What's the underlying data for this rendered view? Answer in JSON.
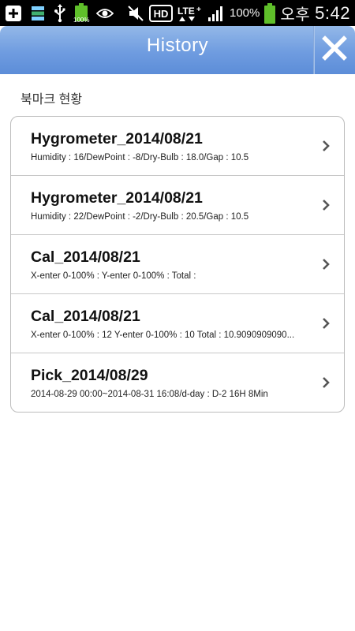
{
  "status_bar": {
    "battery_small_label": "100%",
    "hd_label": "HD",
    "lte_label": "LTE",
    "battery_percent": "100%",
    "ampm": "오후",
    "time": "5:42"
  },
  "header": {
    "title": "History",
    "close_icon": "close-icon"
  },
  "section": {
    "label": "북마크 현황"
  },
  "items": [
    {
      "title": "Hygrometer_2014/08/21",
      "subtitle": "Humidity : 16/DewPoint : -8/Dry-Bulb : 18.0/Gap : 10.5"
    },
    {
      "title": "Hygrometer_2014/08/21",
      "subtitle": "Humidity : 22/DewPoint : -2/Dry-Bulb : 20.5/Gap : 10.5"
    },
    {
      "title": "Cal_2014/08/21",
      "subtitle": "X-enter 0-100% :  Y-enter 0-100% :  Total :"
    },
    {
      "title": "Cal_2014/08/21",
      "subtitle": "X-enter 0-100% : 12 Y-enter 0-100% : 10 Total : 10.9090909090..."
    },
    {
      "title": "Pick_2014/08/29",
      "subtitle": "2014-08-29 00:00~2014-08-31 16:08/d-day : D-2 16H 8Min"
    }
  ],
  "colors": {
    "header_top": "#93b8e8",
    "header_bottom": "#5c8dd8",
    "status_bar": "#000000",
    "battery_green": "#5fbf2a"
  }
}
